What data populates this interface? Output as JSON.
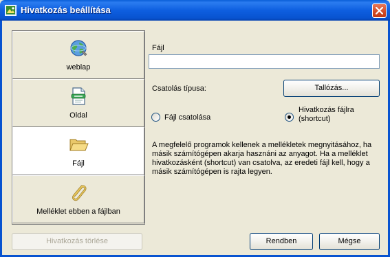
{
  "window": {
    "title": "Hivatkozás beállítása",
    "icon": "window-app-icon",
    "close_icon": "close-icon"
  },
  "sidebar": {
    "items": [
      {
        "label": "weblap",
        "icon": "globe-icon",
        "selected": false
      },
      {
        "label": "Oldal",
        "icon": "page-icon",
        "selected": false
      },
      {
        "label": "Fájl",
        "icon": "folder-icon",
        "selected": true
      },
      {
        "label": "Melléklet ebben a fájlban",
        "icon": "paperclip-icon",
        "selected": false
      }
    ]
  },
  "form": {
    "file_label": "Fájl",
    "file_value": "",
    "link_type_label": "Csatolás típusa:",
    "browse_button": "Tallózás...",
    "radio_attach": {
      "label": "Fájl csatolása",
      "checked": false
    },
    "radio_shortcut": {
      "label_line1": "Hivatkozás fájlra",
      "label_line2": "(shortcut)",
      "checked": true
    },
    "description": "A megfelelő programok kellenek a mellékletek megnyitásához, ha másik számítógépen akarja hasznáni az anyagot. Ha a melléklet hivatkozásként (shortcut) van csatolva, az eredeti fájl kell, hogy a másik számítógépen is rajta legyen."
  },
  "buttons": {
    "remove_link": "Hivatkozás törlése",
    "ok": "Rendben",
    "cancel": "Mégse"
  },
  "colors": {
    "titlebar": "#0853d0",
    "dialog_bg": "#ece9d8",
    "close_button": "#d14a25",
    "radio_checked": "#000000"
  }
}
